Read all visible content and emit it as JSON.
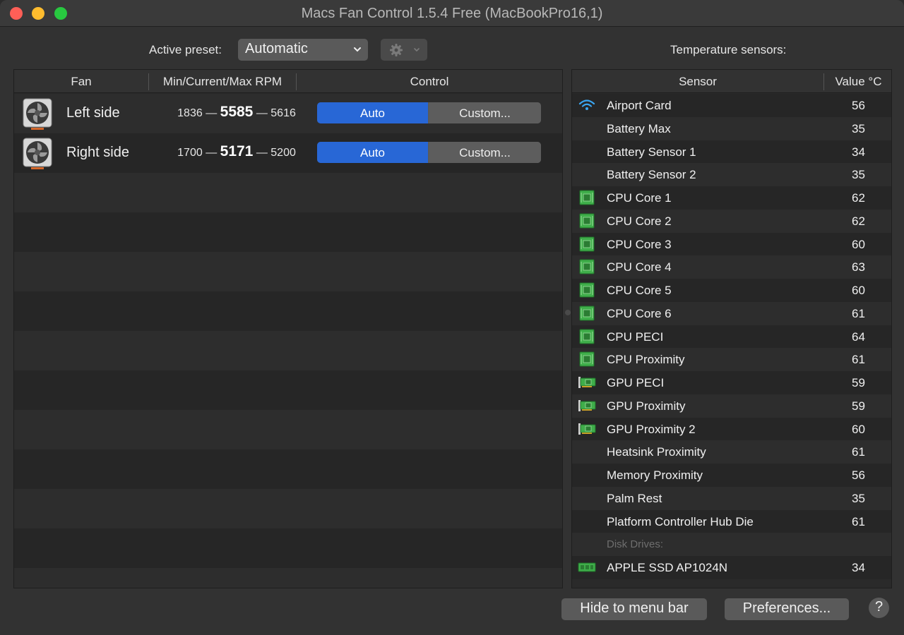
{
  "window": {
    "title": "Macs Fan Control 1.5.4 Free (MacBookPro16,1)"
  },
  "preset": {
    "label": "Active preset:",
    "selected": "Automatic",
    "gear_icon": "gear-icon"
  },
  "fans": {
    "headers": {
      "fan": "Fan",
      "rpm": "Min/Current/Max RPM",
      "control": "Control"
    },
    "rows": [
      {
        "name": "Left side",
        "min": "1836",
        "current": "5585",
        "max": "5616",
        "sep": "—",
        "auto_label": "Auto",
        "custom_label": "Custom..."
      },
      {
        "name": "Right side",
        "min": "1700",
        "current": "5171",
        "max": "5200",
        "sep": "—",
        "auto_label": "Auto",
        "custom_label": "Custom..."
      }
    ]
  },
  "sensors": {
    "label": "Temperature sensors:",
    "headers": {
      "sensor": "Sensor",
      "value": "Value °C"
    },
    "rows": [
      {
        "name": "Airport Card",
        "value": "56",
        "icon": "wifi-icon"
      },
      {
        "name": "Battery Max",
        "value": "35",
        "icon": ""
      },
      {
        "name": "Battery Sensor 1",
        "value": "34",
        "icon": ""
      },
      {
        "name": "Battery Sensor 2",
        "value": "35",
        "icon": ""
      },
      {
        "name": "CPU Core 1",
        "value": "62",
        "icon": "cpu-chip-icon"
      },
      {
        "name": "CPU Core 2",
        "value": "62",
        "icon": "cpu-chip-icon"
      },
      {
        "name": "CPU Core 3",
        "value": "60",
        "icon": "cpu-chip-icon"
      },
      {
        "name": "CPU Core 4",
        "value": "63",
        "icon": "cpu-chip-icon"
      },
      {
        "name": "CPU Core 5",
        "value": "60",
        "icon": "cpu-chip-icon"
      },
      {
        "name": "CPU Core 6",
        "value": "61",
        "icon": "cpu-chip-icon"
      },
      {
        "name": "CPU PECI",
        "value": "64",
        "icon": "cpu-chip-icon"
      },
      {
        "name": "CPU Proximity",
        "value": "61",
        "icon": "cpu-chip-icon"
      },
      {
        "name": "GPU PECI",
        "value": "59",
        "icon": "gpu-card-icon"
      },
      {
        "name": "GPU Proximity",
        "value": "59",
        "icon": "gpu-card-icon"
      },
      {
        "name": "GPU Proximity 2",
        "value": "60",
        "icon": "gpu-card-icon"
      },
      {
        "name": "Heatsink Proximity",
        "value": "61",
        "icon": ""
      },
      {
        "name": "Memory Proximity",
        "value": "56",
        "icon": ""
      },
      {
        "name": "Palm Rest",
        "value": "35",
        "icon": ""
      },
      {
        "name": "Platform Controller Hub Die",
        "value": "61",
        "icon": ""
      }
    ],
    "disk_section_label": "Disk Drives:",
    "disks": [
      {
        "name": "APPLE SSD AP1024N",
        "value": "34",
        "icon": "ssd-icon"
      }
    ]
  },
  "footer": {
    "hide_label": "Hide to menu bar",
    "prefs_label": "Preferences...",
    "help_label": "?"
  },
  "colors": {
    "accent": "#2867d6",
    "close": "#fe5f57",
    "minimize": "#febc2e",
    "maximize": "#28c840",
    "chip_green": "#3fae4a"
  }
}
